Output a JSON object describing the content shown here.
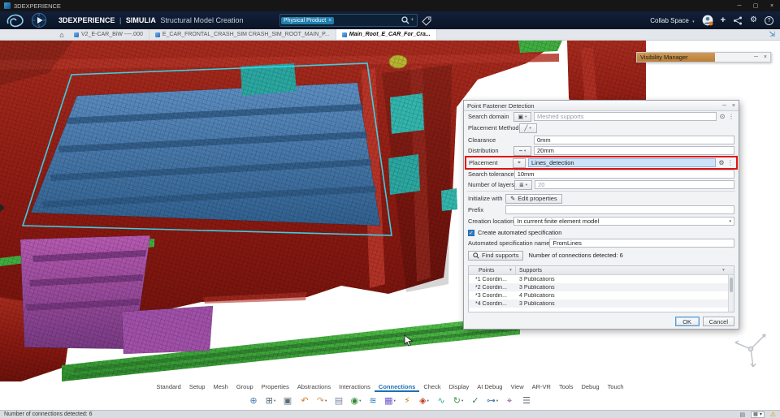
{
  "window": {
    "title": "3DEXPERIENCE",
    "minimize": "─",
    "maximize": "▢",
    "close": "×"
  },
  "ui": {
    "caret": "▾"
  },
  "app_bar": {
    "brand": "3DEXPERIENCE",
    "separator": "|",
    "product": "SIMULIA",
    "app_name": "Structural Model Creation",
    "search": {
      "chip": "Physical Product",
      "chip_close": "×",
      "plus": "+",
      "value": ""
    },
    "collab_space": "Collab Space",
    "add_label": "+",
    "gear_glyph": "⚙",
    "help_label": "?"
  },
  "tab_bar": {
    "home_glyph": "⌂",
    "expand_glyph": "⇲",
    "tabs": [
      {
        "label": "V2_E-CAR_BiW ----.000",
        "active": false
      },
      {
        "label": "E_CAR_FRONTAL_CRASH_SIM CRASH_SIM_ROOT_MAIN_P...",
        "active": false
      },
      {
        "label": "Main_Root_E_CAR_For_Cra...",
        "active": true
      }
    ]
  },
  "visibility_manager": {
    "title": "Visibility Manager",
    "minimize": "─",
    "close": "×"
  },
  "dialog": {
    "title": "Point Fastener Detection",
    "minimize": "─",
    "close": "×",
    "highlight_color": "#e01313",
    "selection_color": "#cfe3f8",
    "rows": {
      "search_domain": {
        "label": "Search domain",
        "value": "Meshed supports"
      },
      "placement_method": {
        "label": "Placement Method"
      },
      "clearance": {
        "label": "Clearance",
        "value": "0mm"
      },
      "distribution": {
        "label": "Distribution",
        "value": "20mm"
      },
      "placement": {
        "label": "Placement",
        "value": "Lines_detection"
      },
      "search_tolerance": {
        "label": "Search tolerance",
        "value": "10mm"
      },
      "number_of_layers": {
        "label": "Number of layers",
        "value": "20"
      },
      "initialize_with": {
        "label": "Initialize with",
        "button": "Edit properties"
      },
      "prefix": {
        "label": "Prefix",
        "value": ""
      },
      "creation_location": {
        "label": "Creation location",
        "value": "In current finite element model"
      },
      "create_spec": {
        "label": "Create automated specification",
        "checked": true
      },
      "spec_name": {
        "label": "Automated specification name",
        "value": "FromLines"
      }
    },
    "icons": {
      "search_domain_btn": "▣",
      "placement_method_btn": "╱",
      "distribution_btn": "┉",
      "placement_btn": "⌖",
      "layers_btn": "≣",
      "edit_props": "✎",
      "gear": "⚙",
      "dots": "⋮",
      "target": "⊙",
      "check": "✓",
      "funnel": "▼"
    },
    "find_button": "Find supports",
    "detected_text": "Number of connections detected: 6",
    "results": {
      "columns": [
        "Points",
        "Supports"
      ],
      "rows": [
        {
          "point": "*1 Coordin...",
          "supports": "3 Publications"
        },
        {
          "point": "*2 Coordin...",
          "supports": "3 Publications"
        },
        {
          "point": "*3 Coordin...",
          "supports": "4 Publications"
        },
        {
          "point": "*4 Coordin...",
          "supports": "3 Publications"
        }
      ]
    },
    "ok": "OK",
    "cancel": "Cancel"
  },
  "ribbon": {
    "tabs": [
      {
        "label": "Standard"
      },
      {
        "label": "Setup"
      },
      {
        "label": "Mesh"
      },
      {
        "label": "Group"
      },
      {
        "label": "Properties"
      },
      {
        "label": "Abstractions"
      },
      {
        "label": "Interactions"
      },
      {
        "label": "Connections",
        "active": true
      },
      {
        "label": "Check"
      },
      {
        "label": "Display"
      },
      {
        "label": "AI Debug"
      },
      {
        "label": "View"
      },
      {
        "label": "AR-VR"
      },
      {
        "label": "Tools"
      },
      {
        "label": "Debug"
      },
      {
        "label": "Touch"
      }
    ]
  },
  "toolbar": {
    "caret": "▾",
    "icons": [
      {
        "name": "zoom-in-icon",
        "glyph": "⊕",
        "color": "#4a7fb5",
        "caret": false
      },
      {
        "name": "viewport-layout-icon",
        "glyph": "⊞",
        "color": "#5a6b7a",
        "caret": true
      },
      {
        "name": "window-icon",
        "glyph": "▣",
        "color": "#5a6b7a",
        "caret": false
      },
      {
        "name": "undo-icon",
        "glyph": "↶",
        "color": "#e07b20",
        "caret": false
      },
      {
        "name": "redo-icon",
        "glyph": "↷",
        "color": "#cf9d6c",
        "caret": true
      },
      {
        "name": "clipboard-icon",
        "glyph": "▤",
        "color": "#7a8aa0",
        "caret": false
      },
      {
        "name": "point-fastener-icon",
        "glyph": "◉",
        "color": "#2e8b33",
        "caret": true
      },
      {
        "name": "line-fastener-icon",
        "glyph": "≋",
        "color": "#2a7ab5",
        "caret": false
      },
      {
        "name": "surface-fastener-icon",
        "glyph": "▦",
        "color": "#6a5acd",
        "caret": true
      },
      {
        "name": "bolt-icon",
        "glyph": "⚡",
        "color": "#b8860b",
        "caret": false
      },
      {
        "name": "spot-weld-icon",
        "glyph": "◈",
        "color": "#c23b22",
        "caret": true
      },
      {
        "name": "seam-weld-icon",
        "glyph": "∿",
        "color": "#2aa7a0",
        "caret": false
      },
      {
        "name": "update-icon",
        "glyph": "↻",
        "color": "#3f9b43",
        "caret": true
      },
      {
        "name": "check-connections-icon",
        "glyph": "✓",
        "color": "#2e8b33",
        "caret": false
      },
      {
        "name": "link-icon",
        "glyph": "⊶",
        "color": "#4a7fb5",
        "caret": true
      },
      {
        "name": "measure-icon",
        "glyph": "⌖",
        "color": "#8a4a9b",
        "caret": false
      },
      {
        "name": "touch-mode-icon",
        "glyph": "☰",
        "color": "#5a6b7a",
        "caret": false
      }
    ]
  },
  "status_bar": {
    "message": "Number of connections detected: 6",
    "select_glyph": "▦",
    "select_caret": "▾",
    "mode_glyph": "▤",
    "warning_glyph": "⚠"
  },
  "scene": {
    "colors": {
      "mesh_red": "#8c1a12",
      "panel_blue": "#3f6fa8",
      "green": "#3fae3f",
      "purple": "#9b4a9b",
      "cyan": "#35d8f0",
      "teal": "#2aa7a0",
      "olive": "#b9b431"
    }
  }
}
